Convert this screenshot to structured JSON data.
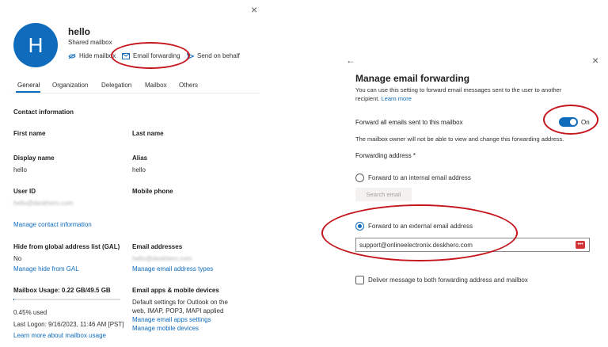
{
  "left": {
    "close_glyph": "×",
    "avatar_letter": "H",
    "name": "hello",
    "subtitle": "Shared mailbox",
    "actions": [
      {
        "label": "Hide mailbox",
        "icon": "eye-off-icon"
      },
      {
        "label": "Email forwarding",
        "icon": "mail-forward-icon"
      },
      {
        "label": "Send on behalf",
        "icon": "send-icon"
      }
    ],
    "tabs": [
      "General",
      "Organization",
      "Delegation",
      "Mailbox",
      "Others"
    ],
    "contact_header": "Contact information",
    "fields": {
      "first_name_label": "First name",
      "last_name_label": "Last name",
      "display_name_label": "Display name",
      "display_name_value": "hello",
      "alias_label": "Alias",
      "alias_value": "hello",
      "user_id_label": "User ID",
      "user_id_value": "hello@deskhero.com",
      "mobile_phone_label": "Mobile phone"
    },
    "manage_contact_link": "Manage contact information",
    "gal_label": "Hide from global address list (GAL)",
    "gal_value": "No",
    "gal_link": "Manage hide from GAL",
    "email_addresses_label": "Email addresses",
    "email_addresses_value": "hello@deskhero.com",
    "email_addresses_link": "Manage email address types",
    "usage_label": "Mailbox Usage: 0.22 GB/49.5 GB",
    "usage_fraction": 0.0045,
    "usage_percent": "0.45% used",
    "last_logon": "Last Logon: 9/16/2023, 11:46 AM [PST]",
    "usage_link": "Learn more about mailbox usage",
    "apps_label": "Email apps & mobile devices",
    "apps_desc_1": "Default settings for Outlook on the",
    "apps_desc_2": "web, IMAP, POP3, MAPI applied",
    "apps_link_1": "Manage email apps settings",
    "apps_link_2": "Manage mobile devices"
  },
  "right": {
    "back_glyph": "←",
    "close_glyph": "×",
    "title": "Manage email forwarding",
    "desc_1": "You can use this setting to forward email messages sent to the user to another",
    "desc_2": "recipient.",
    "learn_more": "Learn more",
    "forward_all_label": "Forward all emails sent to this mailbox",
    "toggle_state": "On",
    "toggle_on": true,
    "owner_note": "The mailbox owner will not be able to view and change this forwarding address.",
    "forwarding_address_label": "Forwarding address *",
    "internal_option": "Forward to an internal email address",
    "search_button": "Search email",
    "external_option": "Forward to an external email address",
    "external_value": "support@onlineelectronix.deskhero.com",
    "deliver_both": "Deliver message to both forwarding address and mailbox"
  },
  "colors": {
    "accent": "#0f6cbd",
    "avatar": "#0f6cbd",
    "annotation": "#c4161c"
  }
}
